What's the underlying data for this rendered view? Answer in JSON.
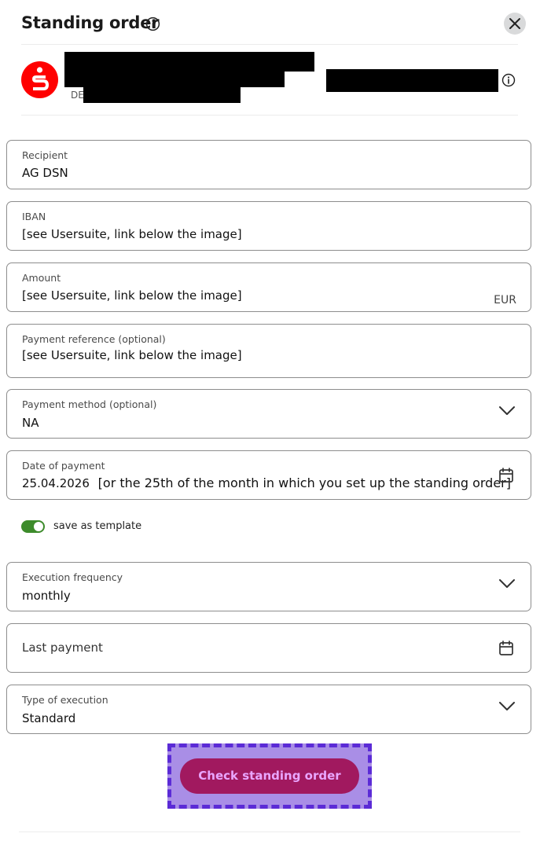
{
  "header": {
    "title": "Standing order",
    "info_icon": "info-icon",
    "close_icon": "close-icon"
  },
  "account": {
    "bank_logo": "sparkasse-s-icon",
    "iban_prefix": "DE",
    "info_icon": "info-icon"
  },
  "fields": {
    "recipient": {
      "label": "Recipient",
      "value": "AG DSN"
    },
    "iban": {
      "label": "IBAN",
      "value": "[see Usersuite, link below the image]"
    },
    "amount": {
      "label": "Amount",
      "value": "[see Usersuite, link below the image]",
      "currency": "EUR"
    },
    "reference": {
      "label": "Payment reference (optional)",
      "value": "[see Usersuite, link below the image]"
    },
    "payment_method": {
      "label": "Payment method (optional)",
      "value": "NA"
    },
    "date": {
      "label": "Date of payment",
      "value": "25.04.2026",
      "note": "[or the 25th of the month in which you set up the standing order]"
    },
    "frequency": {
      "label": "Execution frequency",
      "value": "monthly"
    },
    "last_payment": {
      "placeholder": "Last payment"
    },
    "execution_type": {
      "label": "Type of execution",
      "value": "Standard"
    }
  },
  "template_toggle": {
    "label": "save as template",
    "on": true
  },
  "cta": {
    "label": "Check standing order"
  },
  "colors": {
    "brand_red": "#ff0000",
    "toggle_on": "#3d8b2b",
    "cta_bg": "#a1195f",
    "cta_text": "#e9a6ff",
    "highlight_fill": "#a98ee6",
    "highlight_border": "#5b2bd6"
  }
}
